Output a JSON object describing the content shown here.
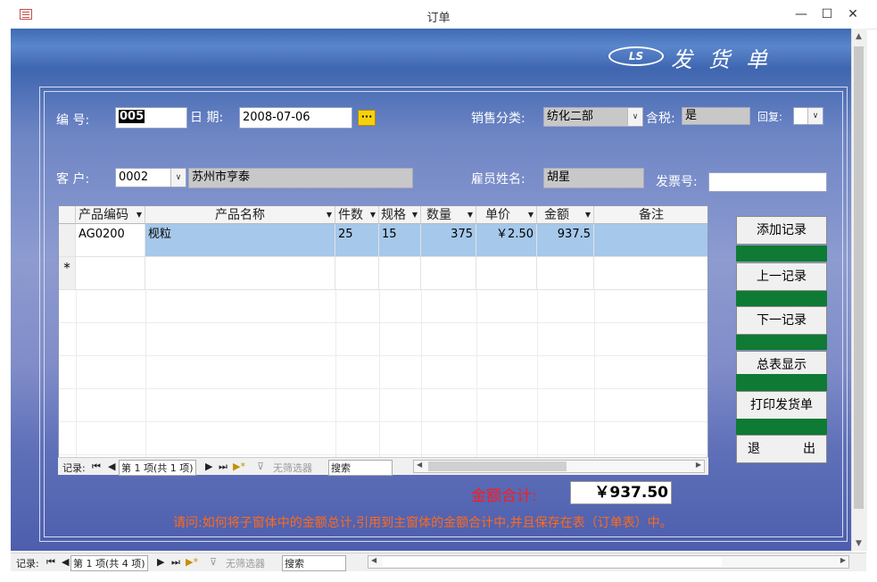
{
  "window": {
    "title": "订单",
    "minimize": "—",
    "maximize": "☐",
    "close": "✕"
  },
  "logo": {
    "badge": "LS",
    "title": "发货单"
  },
  "form": {
    "number_label": "编  号:",
    "number_value": "005",
    "date_label": "日  期:",
    "date_value": "2008-07-06",
    "date_button": "···",
    "sales_category_label": "销售分类:",
    "sales_category_value": "纺化二部",
    "tax_label": "含税:",
    "tax_value": "是",
    "reply_label": "回复:",
    "reply_value": "",
    "customer_label": "客  户:",
    "customer_code": "0002",
    "customer_name": "苏州市亨泰",
    "employee_label": "雇员姓名:",
    "employee_value": "胡星",
    "invoice_label": "发票号:",
    "invoice_value": ""
  },
  "datasheet": {
    "columns": [
      "产品编码",
      "产品名称",
      "件数",
      "规格",
      "数量",
      "单价",
      "金额",
      "备注"
    ],
    "rows": [
      {
        "code": "AG0200",
        "name": "枧粒",
        "pieces": "25",
        "spec": "15",
        "qty": "375",
        "price": "￥2.50",
        "amount": "937.5",
        "note": ""
      }
    ],
    "new_row_marker": "*",
    "nav": {
      "record_label": "记录:",
      "position": "第 1 项(共 1 项)",
      "filter": "无筛选器",
      "search": "搜索"
    }
  },
  "buttons": {
    "add": "添加记录",
    "prev": "上一记录",
    "next": "下一记录",
    "summary": "总表显示",
    "print": "打印发货单",
    "exit_left": "退",
    "exit_right": "出"
  },
  "total": {
    "label": "金额合计:",
    "value": "￥937.50"
  },
  "question": "请问:如何将子窗体中的金额总计,引用到主窗体的金额合计中,并且保存在表（订单表）中。",
  "main_nav": {
    "record_label": "记录:",
    "position": "第 1 项(共 4 项)",
    "filter": "无筛选器",
    "search": "搜索"
  }
}
